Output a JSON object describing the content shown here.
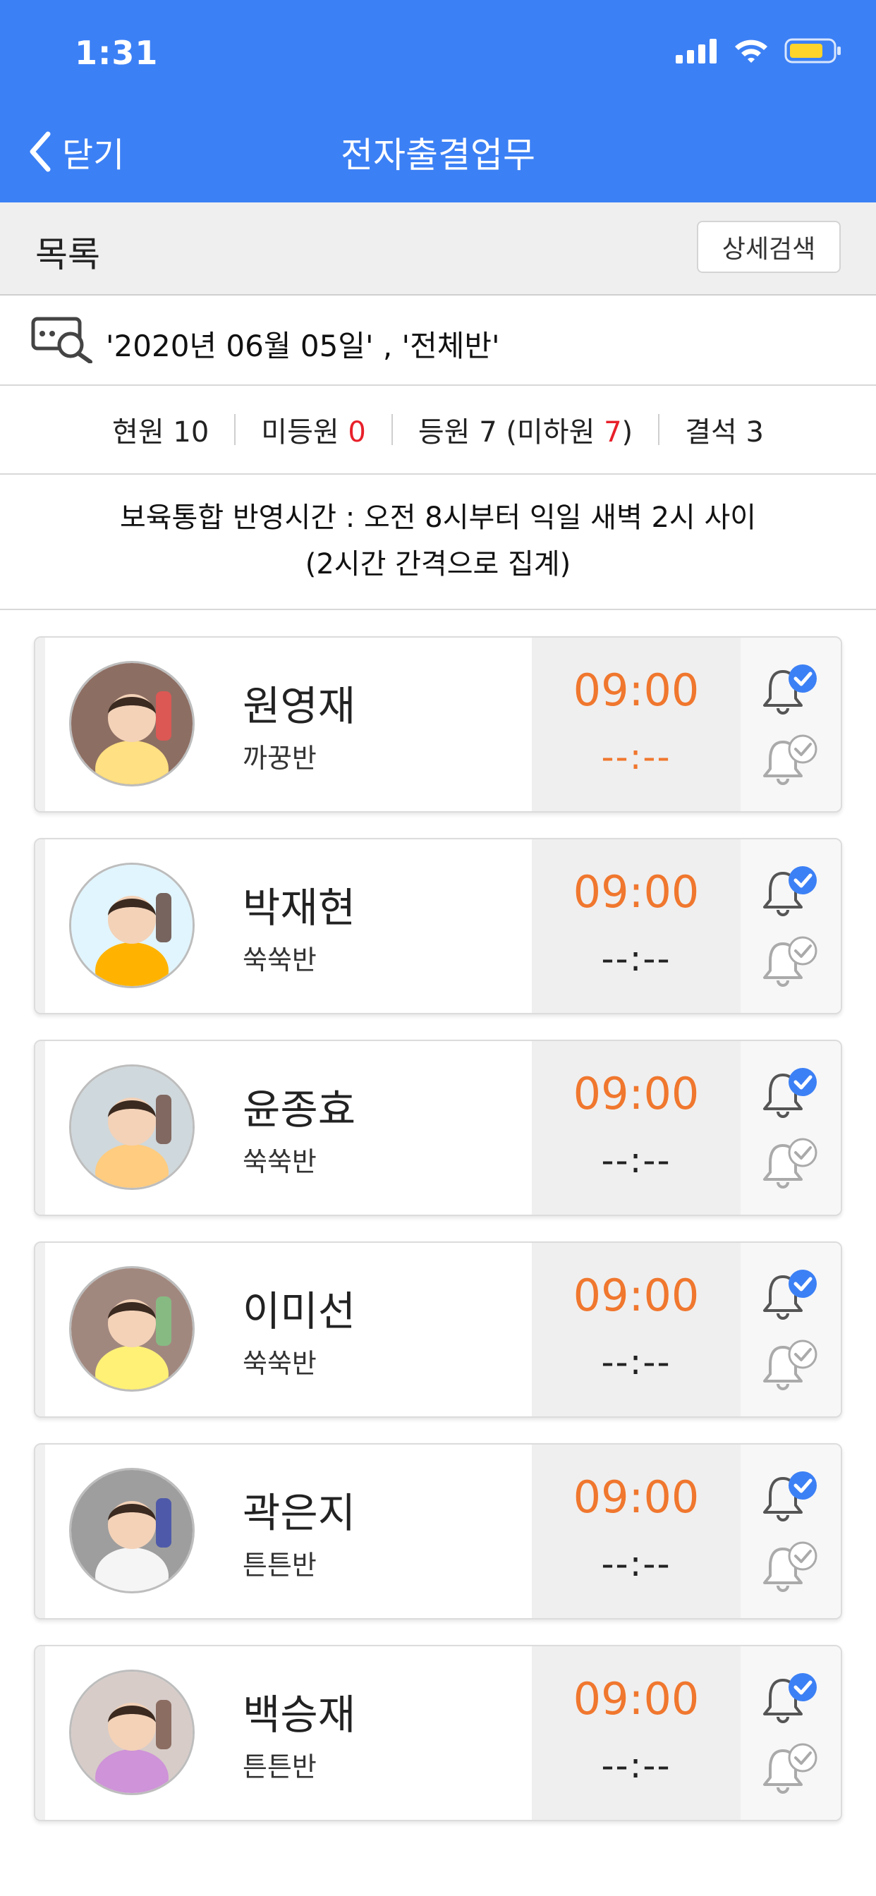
{
  "status_bar": {
    "time": "1:31"
  },
  "nav": {
    "back_label": "닫기",
    "title": "전자출결업무"
  },
  "list_header": {
    "label": "목록",
    "detail_search_label": "상세검색"
  },
  "search_summary": "'2020년 06월 05일' , '전체반'",
  "stats": {
    "enrolled_label": "현원",
    "enrolled_count": "10",
    "not_arrived_label": "미등원",
    "not_arrived_count": "0",
    "arrived_label": "등원",
    "arrived_count": "7",
    "not_left_label": "미하원",
    "not_left_count": "7",
    "absent_label": "결석",
    "absent_count": "3"
  },
  "notice": {
    "line1": "보육통합 반영시간 : 오전 8시부터 익일 새벽 2시 사이",
    "line2": "(2시간 간격으로 집계)"
  },
  "children": [
    {
      "name": "원영재",
      "class": "까꿍반",
      "arrival_time": "09:00",
      "departure_time": "--:--",
      "departure_highlight": true
    },
    {
      "name": "박재현",
      "class": "쑥쑥반",
      "arrival_time": "09:00",
      "departure_time": "--:--",
      "departure_highlight": false
    },
    {
      "name": "윤종효",
      "class": "쑥쑥반",
      "arrival_time": "09:00",
      "departure_time": "--:--",
      "departure_highlight": false
    },
    {
      "name": "이미선",
      "class": "쑥쑥반",
      "arrival_time": "09:00",
      "departure_time": "--:--",
      "departure_highlight": false
    },
    {
      "name": "곽은지",
      "class": "튼튼반",
      "arrival_time": "09:00",
      "departure_time": "--:--",
      "departure_highlight": false
    },
    {
      "name": "백승재",
      "class": "튼튼반",
      "arrival_time": "09:00",
      "departure_time": "--:--",
      "departure_highlight": false
    }
  ],
  "colors": {
    "header_blue": "#3c80f5",
    "time_orange": "#f0772e",
    "count_red": "#e8202a",
    "check_blue": "#3c80f5"
  },
  "icons": [
    "chevron-left-icon",
    "signal-icon",
    "wifi-icon",
    "battery-icon",
    "search-list-icon",
    "bell-checked-icon",
    "bell-pending-icon"
  ]
}
